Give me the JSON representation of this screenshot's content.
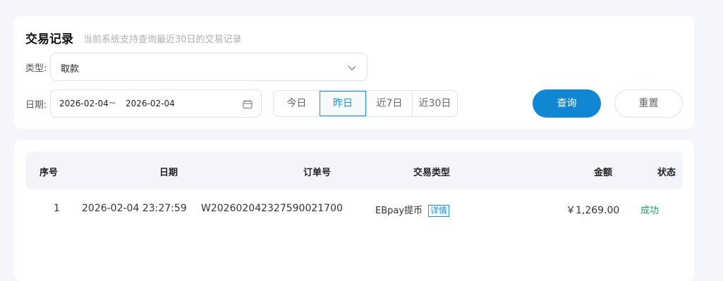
{
  "filter": {
    "title": "交易记录",
    "subtitle": "当前系统支持查询最近30日的交易记录",
    "type_label": "类型:",
    "type_value": "取款",
    "date_label": "日期:",
    "date_start": "2026-02-04",
    "date_separator": "~",
    "date_end": "2026-02-04",
    "quick_ranges": [
      "今日",
      "昨日",
      "近7日",
      "近30日"
    ],
    "active_quick_range": "昨日",
    "query_label": "查询",
    "reset_label": "重置"
  },
  "table": {
    "headers": {
      "index": "序号",
      "date": "日期",
      "order_no": "订单号",
      "tx_type": "交易类型",
      "amount": "金额",
      "status": "状态"
    },
    "rows": [
      {
        "index": "1",
        "date": "2026-02-04 23:27:59",
        "order_no": "W202602042327590021700",
        "tx_type": "EBpay提币",
        "detail_label": "详情",
        "amount": "￥1,269.00",
        "status": "成功"
      }
    ]
  },
  "colors": {
    "primary": "#1187d4",
    "active_outline": "#1f8fd4",
    "success": "#1aa36b",
    "page_background": "#f4f6fb"
  },
  "icons": {
    "type_select": "chevron-down-icon",
    "date_picker": "calendar-icon"
  }
}
